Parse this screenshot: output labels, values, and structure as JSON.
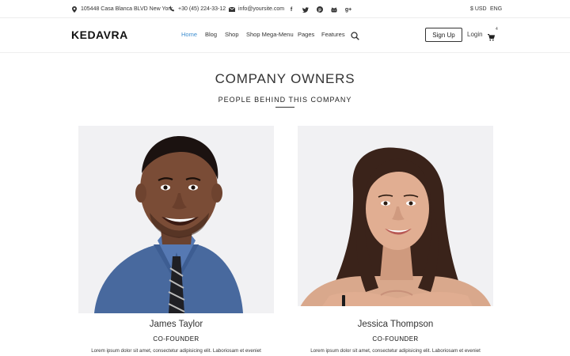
{
  "topbar": {
    "address": "105448 Casa Blanca BLVD New York",
    "phone": "+30 (45) 224-33-12",
    "email": "info@yoursite.com",
    "currency": "$ USD",
    "language": "ENG",
    "social_icons": [
      "facebook-icon",
      "twitter-icon",
      "pinterest-icon",
      "github-icon",
      "google-plus-icon"
    ]
  },
  "header": {
    "logo": "KEDAVRA",
    "nav": [
      "Home",
      "Blog",
      "Shop",
      "Shop Mega-Menu",
      "Pages",
      "Features"
    ],
    "active_nav": "Home",
    "signup": "Sign Up",
    "login": "Login",
    "cart_count": "4"
  },
  "section": {
    "title": "COMPANY OWNERS",
    "subtitle": "PEOPLE BEHIND THIS COMPANY"
  },
  "team": [
    {
      "name": "James Taylor",
      "role": "CO-FOUNDER",
      "bio": "Lorem ipsum dolor sit amet, consectetur adipisicing elit. Laboriosam et eveniet"
    },
    {
      "name": "Jessica Thompson",
      "role": "CO-FOUNDER",
      "bio": "Lorem ipsum dolor sit amet, consectetur adipisicing elit. Laboriosam et eveniet"
    }
  ],
  "colors": {
    "accent": "#3e8ed0",
    "text": "#222222",
    "photo_bg": "#f1f1f3"
  }
}
